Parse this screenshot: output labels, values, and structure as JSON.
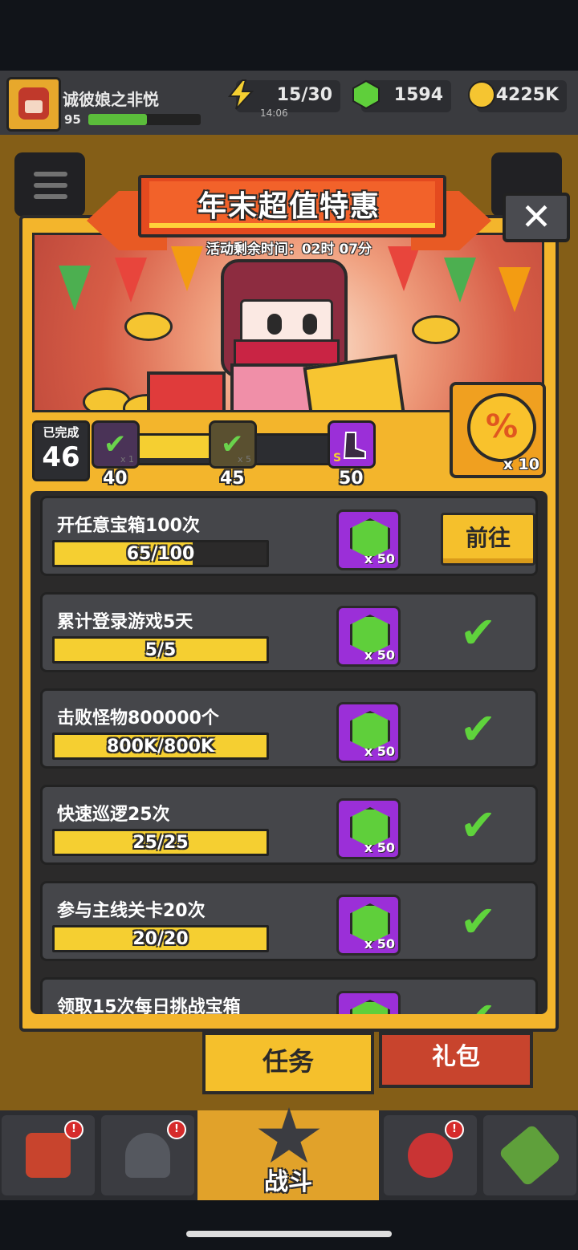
{
  "hud": {
    "player_name": "诚彼娘之非悦",
    "player_level": "95",
    "xp_progress": 0.52,
    "energy": "15/30",
    "energy_timer": "14:06",
    "gems": "1594",
    "coins": "4225K"
  },
  "dialog": {
    "title": "年末超值特惠",
    "timer": "活动剩余时间：02时 07分",
    "close_label": "✕"
  },
  "milestones": {
    "completed_label": "已完成",
    "completed_count": "46",
    "progress_fraction": 0.6,
    "nodes": [
      {
        "threshold": "40",
        "qty": "x 1",
        "claimed": true
      },
      {
        "threshold": "45",
        "qty": "x 5",
        "claimed": true
      },
      {
        "threshold": "50",
        "qty": "",
        "claimed": false,
        "rank": "S"
      }
    ],
    "coupon_qty": "x 10",
    "coupon_symbol": "%"
  },
  "tasks": [
    {
      "name": "开任意宝箱100次",
      "progress": "65/100",
      "fraction": 0.65,
      "reward_qty": "x 50",
      "action": "前往",
      "completed": false
    },
    {
      "name": "累计登录游戏5天",
      "progress": "5/5",
      "fraction": 1.0,
      "reward_qty": "x 50",
      "completed": true
    },
    {
      "name": "击败怪物800000个",
      "progress": "800K/800K",
      "fraction": 1.0,
      "reward_qty": "x 50",
      "completed": true
    },
    {
      "name": "快速巡逻25次",
      "progress": "25/25",
      "fraction": 1.0,
      "reward_qty": "x 50",
      "completed": true
    },
    {
      "name": "参与主线关卡20次",
      "progress": "20/20",
      "fraction": 1.0,
      "reward_qty": "x 50",
      "completed": true
    },
    {
      "name": "领取15次每日挑战宝箱",
      "progress": "",
      "fraction": 1.0,
      "reward_qty": "",
      "completed": true
    }
  ],
  "tabs": {
    "tasks": "任务",
    "gift_pack": "礼包"
  },
  "nav": {
    "fight": "战斗",
    "badge": "!"
  },
  "colors": {
    "panel": "#f3b52c",
    "accent_red": "#e44a1f",
    "progress_yellow": "#f5cf31",
    "gem_green": "#5fcf3b",
    "reward_purple": "#9b2fd8",
    "check_green": "#5fd33c"
  }
}
